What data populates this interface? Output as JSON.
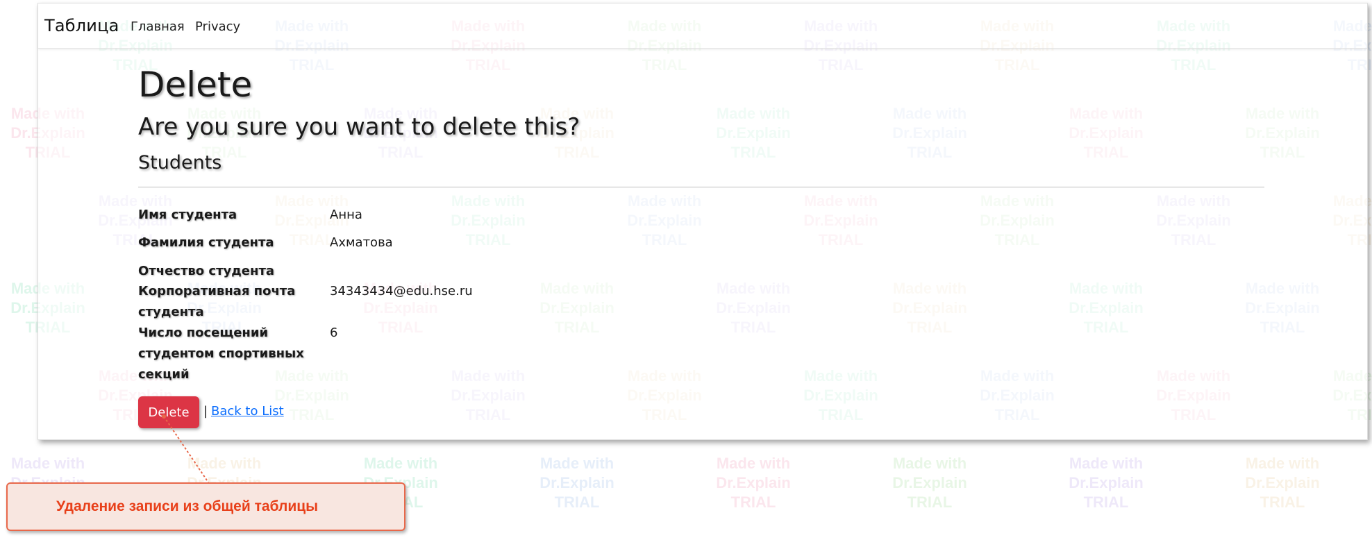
{
  "navbar": {
    "brand": "Таблица",
    "links": [
      "Главная",
      "Privacy"
    ]
  },
  "page": {
    "title": "Delete",
    "question": "Are you sure you want to delete this?",
    "entity": "Students"
  },
  "details": [
    {
      "label": "Имя студента",
      "value": "Анна"
    },
    {
      "label": "Фамилия студента",
      "value": "Ахматова"
    },
    {
      "label": "Отчество студента",
      "value": ""
    },
    {
      "label": "Корпоративная почта студента",
      "value": "34343434@edu.hse.ru"
    },
    {
      "label": "Число посещений студентом спортивных секций",
      "value": "6"
    }
  ],
  "actions": {
    "delete_label": "Delete",
    "separator": "|",
    "back_label": "Back to List"
  },
  "callout": {
    "text": "Удаление записи из общей таблицы"
  },
  "watermark": {
    "lines": [
      "Made with",
      "Dr.Explain",
      "TRIAL"
    ]
  },
  "colors": {
    "delete_button": "#dc3545",
    "link": "#0d6efd",
    "callout_border": "#e8684a",
    "callout_text": "#e8401a",
    "callout_background": "#f8e6e0"
  }
}
